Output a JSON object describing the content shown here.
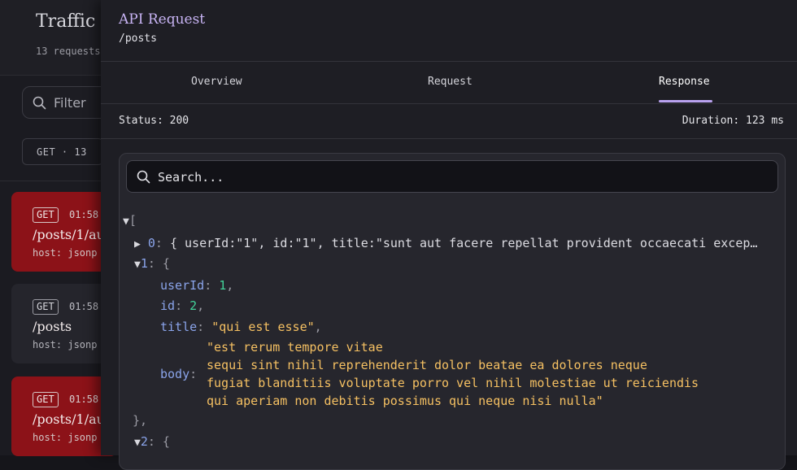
{
  "traffic": {
    "title": "Traffic",
    "count": "13 requests",
    "filter_placeholder": "Filter",
    "method_chip": "GET · 13",
    "requests": [
      {
        "method": "GET",
        "time": "01:58",
        "path": "/posts/1/au",
        "host": "host: jsonp"
      },
      {
        "method": "GET",
        "time": "01:58",
        "path": "/posts",
        "host": "host: jsonp"
      },
      {
        "method": "GET",
        "time": "01:58",
        "path": "/posts/1/au",
        "host": "host: jsonp"
      }
    ]
  },
  "drawer": {
    "title": "API Request",
    "subtitle": "/posts",
    "tabs": [
      "Overview",
      "Request",
      "Response"
    ],
    "active_tab": "Response",
    "status": "Status: 200",
    "duration": "Duration: 123 ms",
    "search_placeholder": "Search..."
  },
  "json_view": {
    "open_bracket": "[",
    "item0_index": "0",
    "item0_summary": "{ userId:\"1\", id:\"1\", title:\"sunt aut facere repellat provident occaecati excep…",
    "item1_index": "1",
    "item1_open": "{",
    "item1": {
      "userId": "1",
      "id": "2",
      "title": "\"qui est esse\"",
      "body_lines": [
        "\"est rerum tempore vitae",
        "sequi sint nihil reprehenderit dolor beatae ea dolores neque",
        "fugiat blanditiis voluptate porro vel nihil molestiae ut reiciendis",
        "qui aperiam non debitis possimus qui neque nisi nulla\""
      ]
    },
    "item1_close": "},",
    "item2_index": "2",
    "item2_open": "{",
    "keys": {
      "userId": "userId",
      "id": "id",
      "title": "title",
      "body": "body"
    }
  },
  "colors": {
    "accent": "#b9a2ef",
    "error_row": "#8c1218",
    "json_key": "#8aa4ea",
    "json_number": "#43d39a",
    "json_string": "#f5c062"
  }
}
